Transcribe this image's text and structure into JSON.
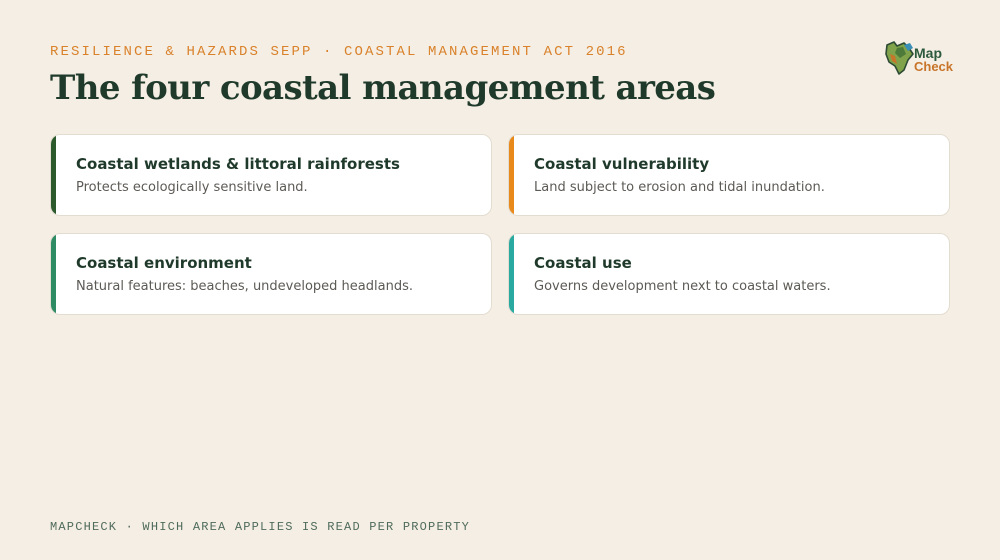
{
  "eyebrow": "RESILIENCE & HAZARDS SEPP · COASTAL MANAGEMENT ACT 2016",
  "title": "The four coastal management areas",
  "logo": {
    "line1": "Map",
    "line2": "Check",
    "icon": "map-pin-icon"
  },
  "cards": [
    {
      "title": "Coastal wetlands & littoral rainforests",
      "description": "Protects ecologically sensitive land.",
      "accent": "#2d5a2d"
    },
    {
      "title": "Coastal vulnerability",
      "description": "Land subject to erosion and tidal inundation.",
      "accent": "#e8891c"
    },
    {
      "title": "Coastal environment",
      "description": "Natural features: beaches, undeveloped headlands.",
      "accent": "#2e8b63"
    },
    {
      "title": "Coastal use",
      "description": "Governs development next to coastal waters.",
      "accent": "#2aa9a0"
    }
  ],
  "footer": "MAPCHECK · WHICH AREA APPLIES IS READ PER PROPERTY"
}
